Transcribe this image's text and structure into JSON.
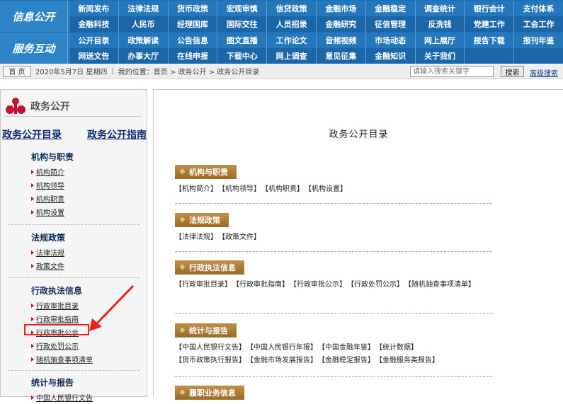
{
  "nav": {
    "group1_label": "信息公开",
    "group2_label": "服务互动",
    "row1": [
      "新闻发布",
      "法律法规",
      "货币政策",
      "宏观审慎",
      "信贷政策",
      "金融市场",
      "金融稳定",
      "调查统计",
      "银行会计",
      "支付体系"
    ],
    "row2": [
      "金融科技",
      "人民币",
      "经理国库",
      "国际交往",
      "人员招录",
      "金融研究",
      "征信管理",
      "反洗钱",
      "党建工作",
      "工会工作"
    ],
    "row3": [
      "公开目录",
      "政策解读",
      "公告信息",
      "图文直播",
      "工作论文",
      "音频视频",
      "市场动态",
      "网上展厅",
      "报告下载",
      "报刊年鉴"
    ],
    "row4": [
      "网送文告",
      "办事大厅",
      "在线申报",
      "下载中心",
      "网上调查",
      "意见征集",
      "金融知识",
      "关于我们"
    ]
  },
  "status": {
    "home_button": "首 页",
    "date": "2020年5月7日 星期四",
    "sep": "|",
    "location": "我的位置：首页 > 政务公开 > 政务公开目录",
    "search_placeholder": "请输入搜索关键字",
    "search_button": "搜索",
    "advanced_search": "高级搜索"
  },
  "sidebar": {
    "title": "政务公开",
    "link_catalog": "政务公开目录",
    "link_guide": "政务公开指南",
    "sections": [
      {
        "heading": "机构与职责",
        "items": [
          "机构简介",
          "机构领导",
          "机构职责",
          "机构设置"
        ]
      },
      {
        "heading": "法规政策",
        "items": [
          "法律法规",
          "政策文件"
        ]
      },
      {
        "heading": "行政执法信息",
        "items": [
          "行政审批目录",
          "行政审批指南",
          "行政审批公示",
          "行政处罚公示",
          "随机抽查事项清单"
        ]
      },
      {
        "heading": "统计与报告",
        "items": [
          "中国人民银行文告"
        ]
      }
    ]
  },
  "content": {
    "title": "政务公开目录",
    "sections": [
      {
        "heading": "机构与职责",
        "items": [
          "【机构简介】",
          "【机构领导】",
          "【机构职责】",
          "【机构设置】"
        ]
      },
      {
        "heading": "法规政策",
        "items": [
          "【法律法规】",
          "【政策文件】"
        ]
      },
      {
        "heading": "行政执法信息",
        "items": [
          "【行政审批目录】",
          "【行政审批指南】",
          "【行政审批公示】",
          "【行政处罚公示】",
          "【随机抽查事项清单】"
        ]
      },
      {
        "heading": "统计与报告",
        "items": [
          "【中国人民银行文告】",
          "【中国人民银行年报】",
          "【中国金融年鉴】",
          "【统计数据】",
          "【货币政策执行报告】",
          "【金融市场发展报告】",
          "【金融稳定报告】",
          "【金融服务类报告】"
        ]
      },
      {
        "heading": "履职业务信息",
        "items": []
      }
    ]
  },
  "colors": {
    "nav_blue": "#1d6fb3",
    "section_gold": "#a8742e",
    "highlight_red": "#e52222"
  }
}
